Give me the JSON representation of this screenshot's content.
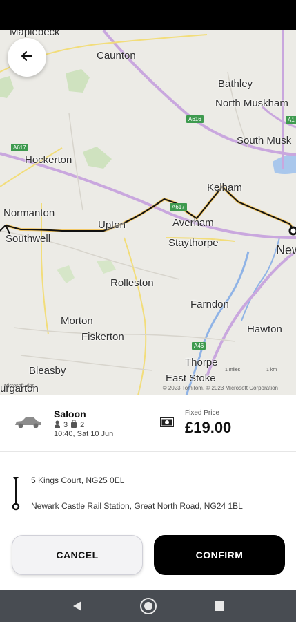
{
  "map": {
    "towns": [
      {
        "name": "Maplebeck"
      },
      {
        "name": "Caunton"
      },
      {
        "name": "Bathley"
      },
      {
        "name": "North Muskham"
      },
      {
        "name": "South Musk"
      },
      {
        "name": "Hockerton"
      },
      {
        "name": "Kelham"
      },
      {
        "name": "Normanton"
      },
      {
        "name": "Upton"
      },
      {
        "name": "Averham"
      },
      {
        "name": "Southwell"
      },
      {
        "name": "Staythorpe"
      },
      {
        "name": "New"
      },
      {
        "name": "Rolleston"
      },
      {
        "name": "Farndon"
      },
      {
        "name": "Morton"
      },
      {
        "name": "Hawton"
      },
      {
        "name": "Fiskerton"
      },
      {
        "name": "Thorpe"
      },
      {
        "name": "Bleasby"
      },
      {
        "name": "East Stoke"
      },
      {
        "name": "urgarton"
      }
    ],
    "roads": [
      "A616",
      "A617",
      "A617",
      "A1",
      "A46"
    ],
    "credit": "© 2023 TomTom, © 2023 Microsoft Corporation",
    "brand": "Microsoft Bing",
    "scale_miles": "1 miles",
    "scale_km": "1 km"
  },
  "ride": {
    "vehicle": "Saloon",
    "passengers": "3",
    "luggage": "2",
    "time": "10:40, Sat 10 Jun",
    "price_label": "Fixed Price",
    "price": "£19.00"
  },
  "route": {
    "pickup": "5 Kings Court, NG25 0EL",
    "dropoff": "Newark Castle Rail Station, Great North Road, NG24 1BL"
  },
  "actions": {
    "cancel": "CANCEL",
    "confirm": "CONFIRM"
  }
}
